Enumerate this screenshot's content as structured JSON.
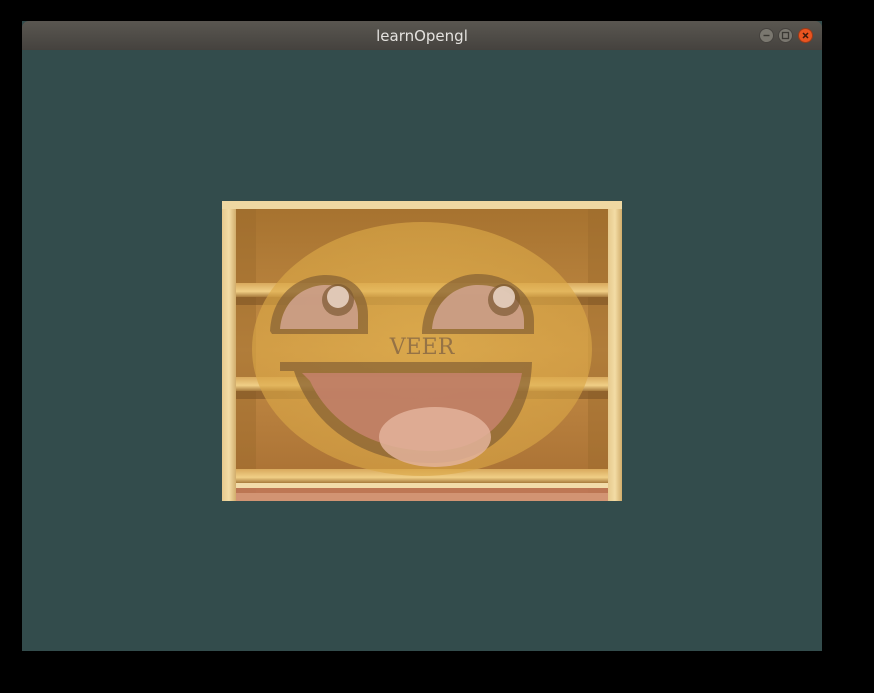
{
  "window": {
    "title": "learnOpengl",
    "clear_color": "#334c4c"
  },
  "titlebar_buttons": {
    "minimize_icon": "minimize-icon",
    "maximize_icon": "maximize-icon",
    "close_icon": "close-icon",
    "close_color": "#e95420"
  },
  "texture": {
    "watermark": "VEER"
  }
}
